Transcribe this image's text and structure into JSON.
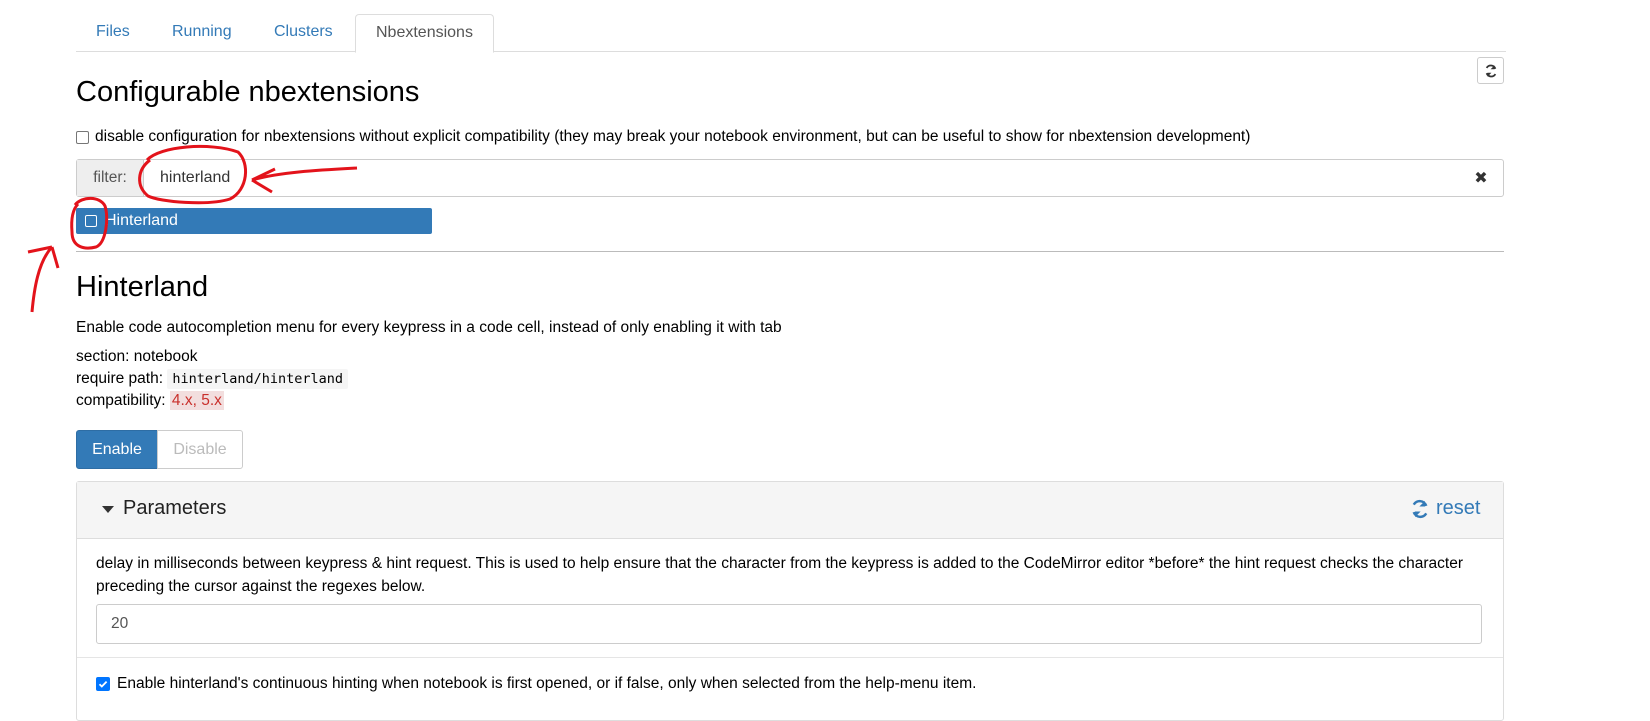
{
  "tabs": [
    {
      "label": "Files"
    },
    {
      "label": "Running"
    },
    {
      "label": "Clusters"
    },
    {
      "label": "Nbextensions"
    }
  ],
  "active_tab": "Nbextensions",
  "page_title": "Configurable nbextensions",
  "compat_checkbox": {
    "checked": false,
    "label": "disable configuration for nbextensions without explicit compatibility (they may break your notebook environment, but can be useful to show for nbextension development)"
  },
  "filter": {
    "addon_label": "filter:",
    "value": "hinterland",
    "clear_icon": "close-icon"
  },
  "extension_list": [
    {
      "label": "Hinterland",
      "selected": true,
      "enabled": false
    }
  ],
  "extension": {
    "title": "Hinterland",
    "description": "Enable code autocompletion menu for every keypress in a code cell, instead of only enabling it with tab",
    "section_label": "section:",
    "section_value": "notebook",
    "require_label": "require path:",
    "require_value": "hinterland/hinterland",
    "compat_label": "compatibility:",
    "compat_value": "4.x, 5.x",
    "enable_label": "Enable",
    "disable_label": "Disable"
  },
  "parameters": {
    "header": "Parameters",
    "reset_label": "reset",
    "items": [
      {
        "description": "delay in milliseconds between keypress & hint request. This is used to help ensure that the character from the keypress is added to the CodeMirror editor *before* the hint request checks the character preceding the cursor against the regexes below.",
        "value": "20"
      },
      {
        "checked": true,
        "description": "Enable hinterland's continuous hinting when notebook is first opened, or if false, only when selected from the help-menu item."
      }
    ]
  },
  "colors": {
    "primary": "#337ab7",
    "annotation": "#e3131b",
    "compat_bg": "#f2dede",
    "compat_text": "#c9302c"
  }
}
